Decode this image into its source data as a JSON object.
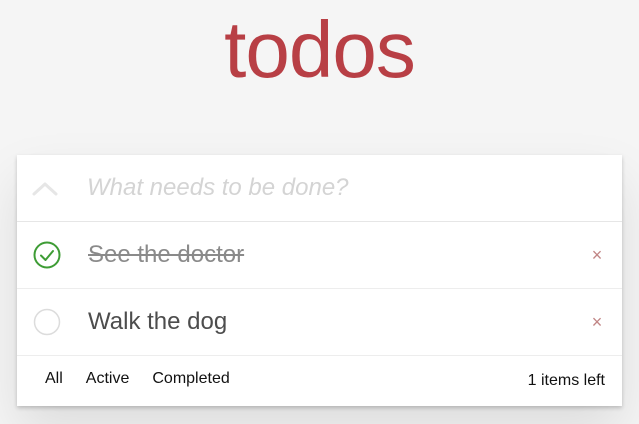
{
  "app": {
    "title": "todos"
  },
  "new_todo": {
    "placeholder": "What needs to be done?",
    "value": ""
  },
  "todos": [
    {
      "label": "See the doctor",
      "completed": true
    },
    {
      "label": "Walk the dog",
      "completed": false
    }
  ],
  "icons": {
    "toggle_all": "chevron-down-icon",
    "check_done": "check-circle-icon",
    "check_empty": "empty-circle-icon",
    "destroy": "close-icon"
  },
  "destroy_glyph": "×",
  "footer": {
    "filters": [
      "All",
      "Active",
      "Completed"
    ],
    "count_text": "1 items left"
  },
  "colors": {
    "title": "#b83f45",
    "check": "#3e9c35",
    "destroy": "#c18585"
  }
}
